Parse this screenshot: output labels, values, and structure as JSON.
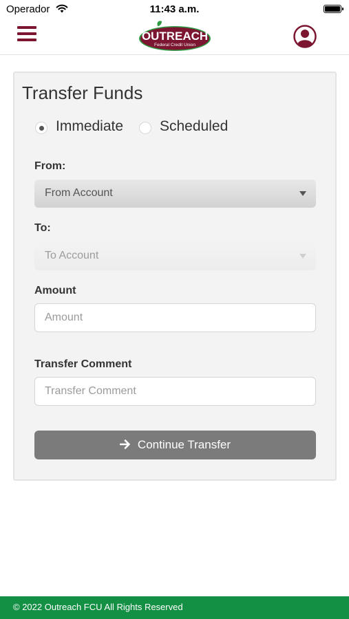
{
  "status_bar": {
    "carrier": "Operador",
    "time": "11:43 a.m.",
    "wifi_icon": "wifi-icon",
    "battery_icon": "battery-full-icon"
  },
  "header": {
    "menu_icon": "hamburger-menu-icon",
    "logo": {
      "name": "OUTREACH",
      "tagline": "Federal Credit Union",
      "brand_color": "#7b1530",
      "leaf_color": "#2e9a43"
    },
    "profile_icon": "user-circle-icon"
  },
  "form": {
    "title": "Transfer Funds",
    "transfer_type": {
      "options": [
        {
          "label": "Immediate",
          "selected": true
        },
        {
          "label": "Scheduled",
          "selected": false
        }
      ]
    },
    "from": {
      "label": "From:",
      "value": "From Account"
    },
    "to": {
      "label": "To:",
      "value": "To Account",
      "disabled": true
    },
    "amount": {
      "label": "Amount",
      "placeholder": "Amount",
      "value": ""
    },
    "comment": {
      "label": "Transfer Comment",
      "placeholder": "Transfer Comment",
      "value": ""
    },
    "continue_button": {
      "label": "Continue Transfer",
      "icon": "arrow-right-icon"
    }
  },
  "footer": {
    "text": "© 2022 Outreach FCU All Rights Reserved",
    "color": "#149045"
  }
}
